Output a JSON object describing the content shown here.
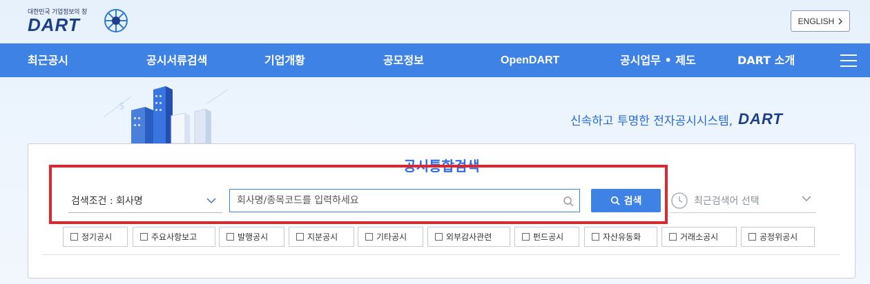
{
  "header": {
    "tagline": "대한민국 기업정보의 창",
    "logo_text": "DART",
    "english_button": "ENGLISH"
  },
  "nav": {
    "items": [
      "최근공시",
      "공시서류검색",
      "기업개황",
      "공모정보",
      "OpenDART",
      "공시업무 • 제도",
      "DART 소개"
    ]
  },
  "banner": {
    "slogan": "신속하고 투명한 전자공시시스템,",
    "slogan_brand": "DART"
  },
  "search": {
    "title": "공시통합검색",
    "condition_label": "검색조건 : 회사명",
    "input_placeholder": "회사명/종목코드를 입력하세요",
    "input_value": "",
    "button_label": "검색",
    "recent_label": "최근검색어 선택"
  },
  "filters": [
    "정기공시",
    "주요사항보고",
    "발행공시",
    "지분공시",
    "기타공시",
    "외부감사관련",
    "펀드공시",
    "자산유동화",
    "거래소공시",
    "공정위공시"
  ],
  "colors": {
    "nav_bg": "#3f82e6",
    "accent": "#2e6ee0",
    "highlight": "#e3242b"
  },
  "icons": [
    "dart-logo-icon",
    "chevron-right-icon",
    "menu-icon",
    "chevron-down-icon",
    "search-icon",
    "clock-icon",
    "checkbox-icon"
  ]
}
